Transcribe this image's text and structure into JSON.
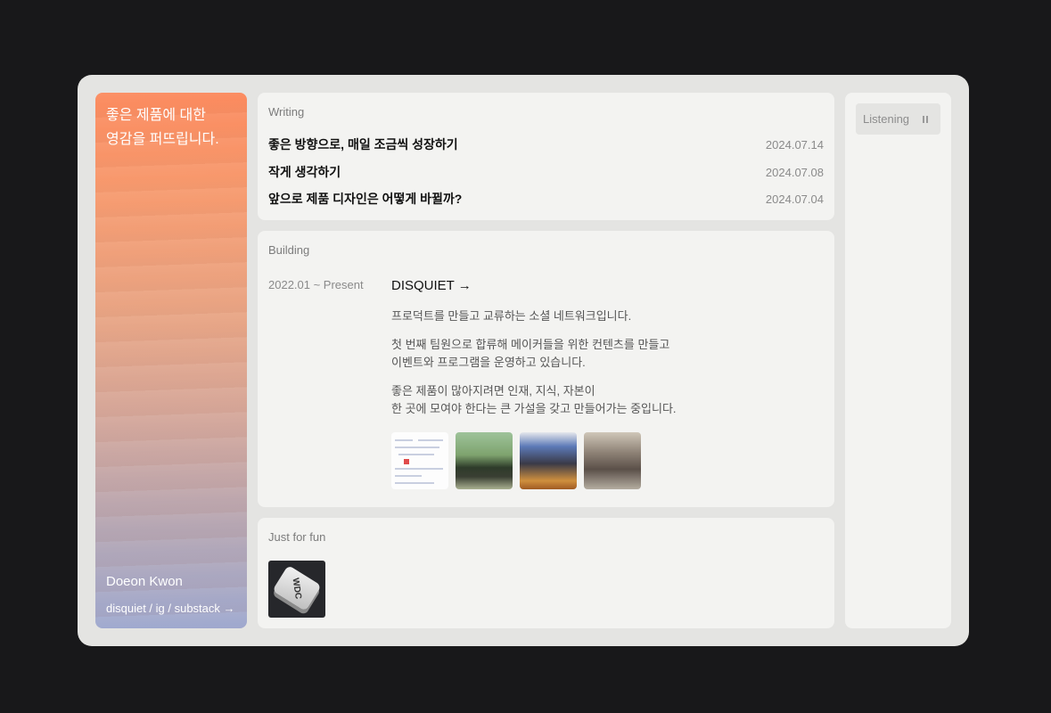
{
  "profile": {
    "tagline": "좋은 제품에 대한\n영감을 퍼뜨립니다.",
    "name": "Doeon Kwon",
    "links": "disquiet / ig / substack →"
  },
  "writing": {
    "label": "Writing",
    "posts": [
      {
        "title": "좋은 방향으로, 매일 조금씩 성장하기",
        "date": "2024.07.14"
      },
      {
        "title": "작게 생각하기",
        "date": "2024.07.08"
      },
      {
        "title": "앞으로 제품 디자인은 어떻게 바뀔까?",
        "date": "2024.07.04"
      }
    ]
  },
  "building": {
    "label": "Building",
    "period": "2022.01 ~ Present",
    "project": "DISQUIET →",
    "paragraphs": [
      "프로덕트를 만들고 교류하는 소셜 네트워크입니다.",
      "첫 번째 팀원으로 합류해 메이커들을 위한 컨텐츠를 만들고\n이벤트와 프로그램을 운영하고 있습니다.",
      "좋은 제품이 많아지려면 인재, 지식, 자본이\n한 곳에 모여야 한다는 큰 가설을 갖고 만들어가는 중입니다."
    ]
  },
  "fun": {
    "label": "Just for fun",
    "keycap_text": "WDC"
  },
  "listening": {
    "label": "Listening",
    "icon": "pause-icon"
  }
}
